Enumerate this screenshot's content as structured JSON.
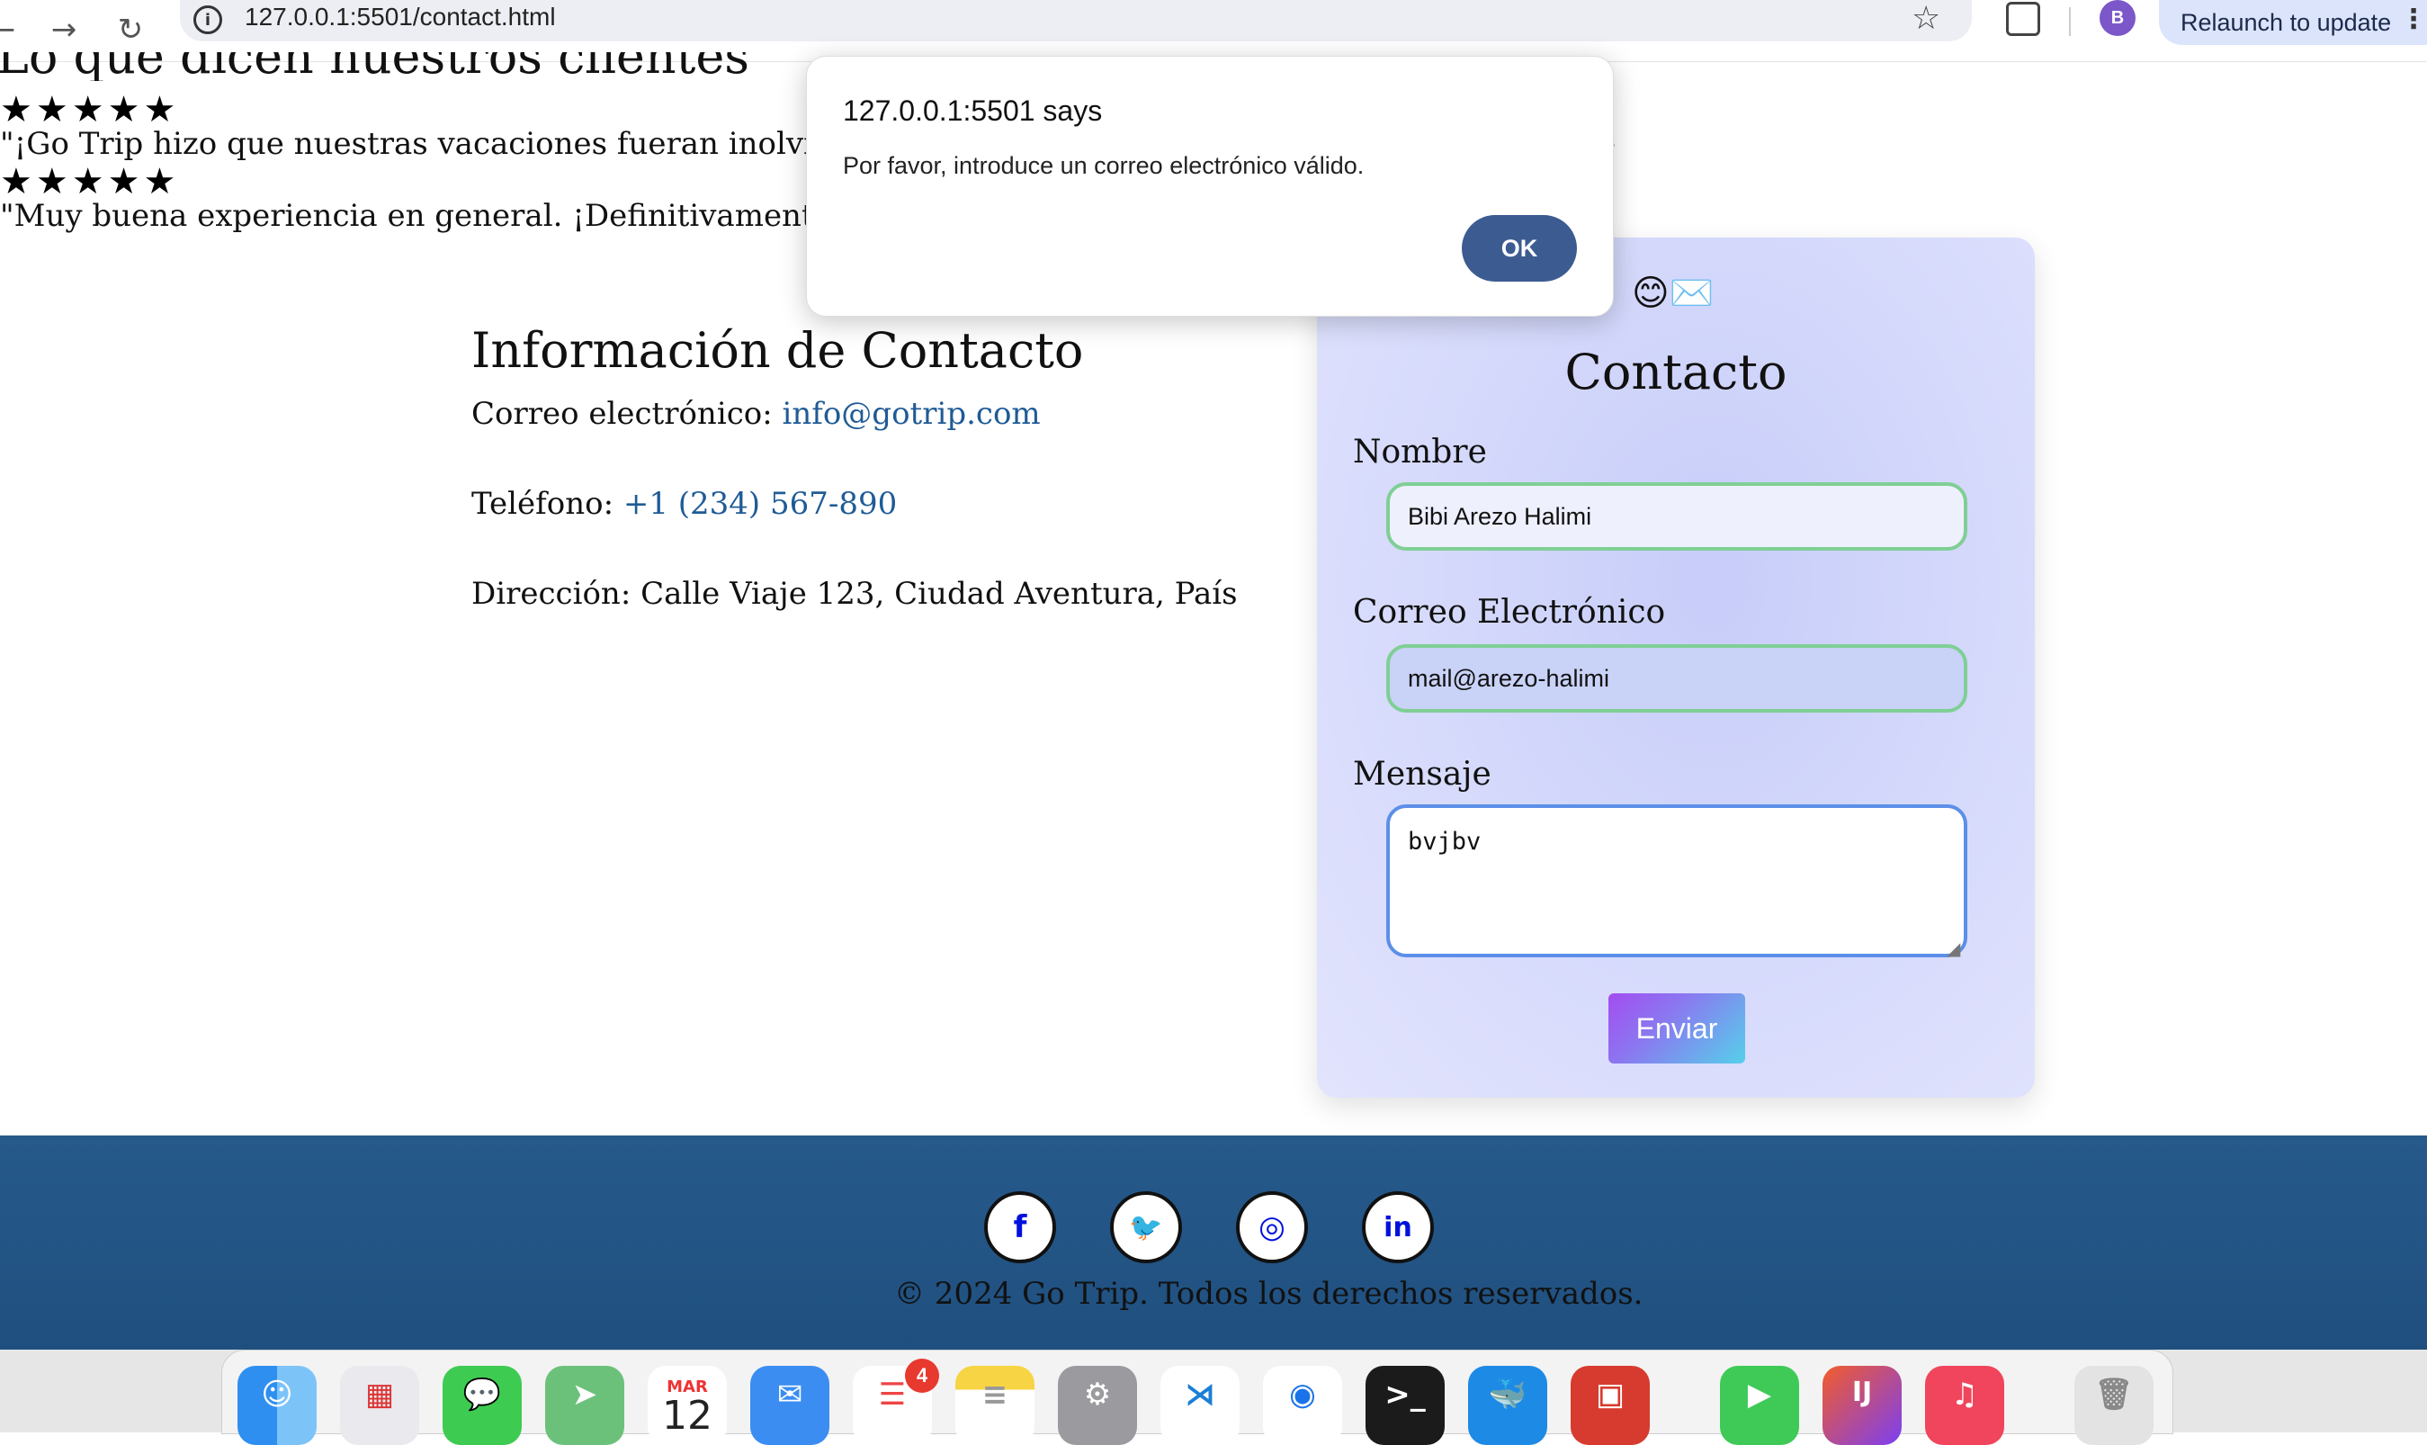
{
  "browser": {
    "url": "127.0.0.1:5501/contact.html",
    "profile_initial": "B",
    "relaunch_label": "Relaunch to update"
  },
  "reviews": {
    "title": "Lo que dicen nuestros clientes",
    "items": [
      {
        "stars": "★★★★★",
        "text": "\"¡Go Trip hizo que nuestras vacaciones fueran inolvidab"
      },
      {
        "stars": "★★★★★",
        "text": "\"Muy buena experiencia en general. ¡Definitivamente v"
      }
    ],
    "overflow_char": "e"
  },
  "contact_info": {
    "title": "Información de Contacto",
    "email_label": "Correo electrónico:",
    "email": "info@gotrip.com",
    "phone_label": "Teléfono:",
    "phone": "+1 (234) 567-890",
    "address_label": "Dirección:",
    "address": "Calle Viaje 123, Ciudad Aventura, País"
  },
  "form": {
    "emoji": "😊✉️",
    "title": "Contacto",
    "name_label": "Nombre",
    "name_value": "Bibi Arezo Halimi",
    "email_label": "Correo Electrónico",
    "email_value": "mail@arezo-halimi",
    "message_label": "Mensaje",
    "message_value": "bvjbv",
    "submit_label": "Enviar"
  },
  "footer": {
    "social": [
      {
        "name": "facebook",
        "glyph": "f"
      },
      {
        "name": "twitter",
        "glyph": "🐦"
      },
      {
        "name": "instagram",
        "glyph": "◎"
      },
      {
        "name": "linkedin",
        "glyph": "in"
      }
    ],
    "copyright": "© 2024 Go Trip. Todos los derechos reservados."
  },
  "dialog": {
    "title": "127.0.0.1:5501 says",
    "message": "Por favor, introduce un correo electrónico válido.",
    "ok_label": "OK"
  },
  "dock": {
    "calendar_month": "MAR",
    "calendar_day": "12",
    "reminders_badge": "4",
    "apps": [
      "finder",
      "launchpad",
      "messages",
      "maps",
      "calendar",
      "mail",
      "reminders",
      "notes",
      "settings",
      "vscode",
      "chrome",
      "terminal",
      "docker",
      "photo-booth",
      "facetime",
      "intellij",
      "music",
      "trash"
    ]
  },
  "colors": {
    "link": "#1f5b96",
    "footer_bg": "#265a8b",
    "ok_button": "#3c5b91",
    "field_border": "#7fcf95"
  }
}
